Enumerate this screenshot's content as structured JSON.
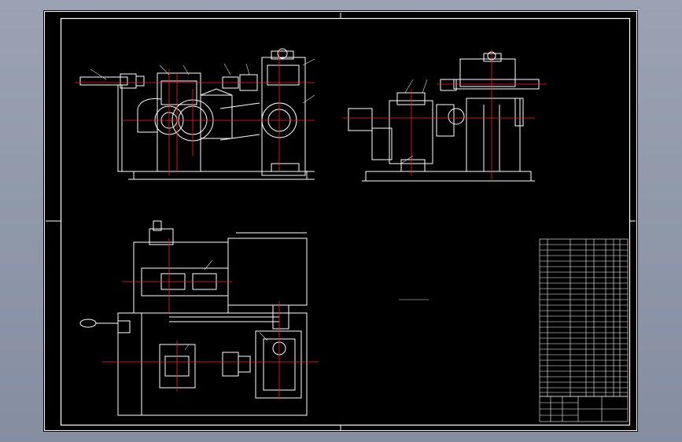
{
  "app": {
    "viewport_background": "#000000",
    "window_background": "#8b93a4"
  },
  "colors": {
    "linework": "#ffffff",
    "centerline": "#ff2020",
    "annotation": "#e0e0e0"
  },
  "drawing": {
    "title_block": {
      "name": "",
      "drawing_number": ""
    },
    "note": ""
  }
}
